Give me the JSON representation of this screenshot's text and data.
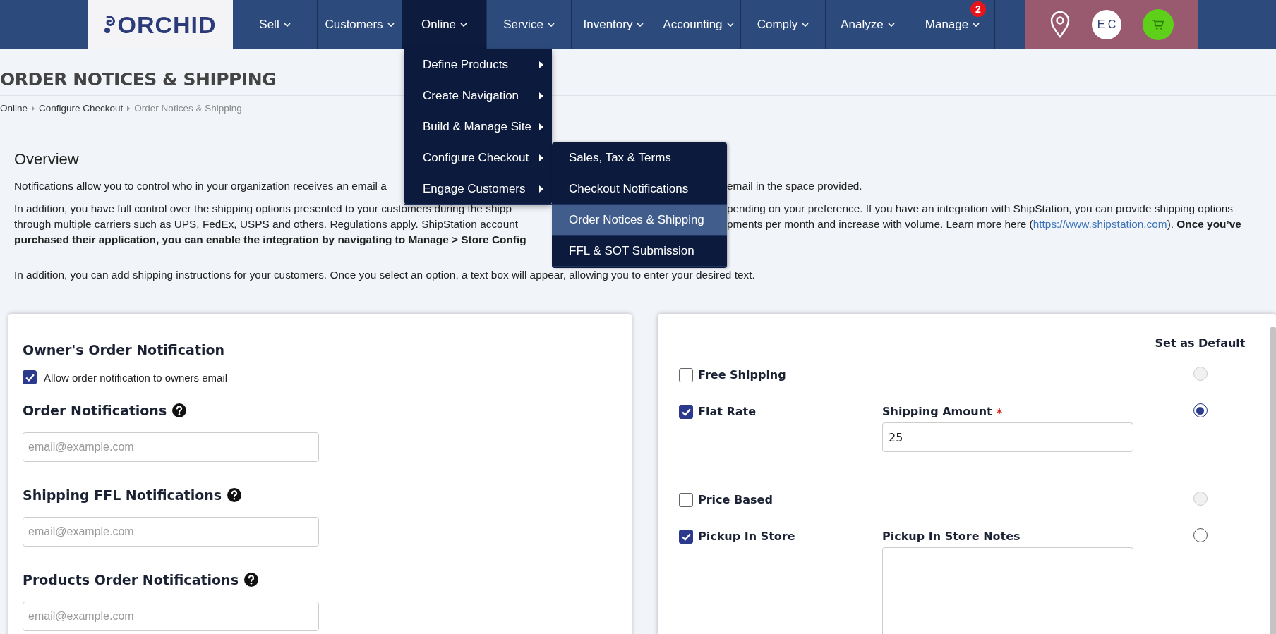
{
  "nav": {
    "logo": "ORCHID",
    "items": [
      {
        "label": "Sell",
        "selected": false
      },
      {
        "label": "Customers",
        "selected": false
      },
      {
        "label": "Online",
        "selected": true
      },
      {
        "label": "Service",
        "selected": false
      },
      {
        "label": "Inventory",
        "selected": false
      },
      {
        "label": "Accounting",
        "selected": false
      },
      {
        "label": "Comply",
        "selected": false
      },
      {
        "label": "Analyze",
        "selected": false
      },
      {
        "label": "Manage",
        "selected": false,
        "badge": "2"
      }
    ],
    "avatar": "E C"
  },
  "page": {
    "title": "ORDER NOTICES & SHIPPING",
    "breadcrumb": [
      "Online",
      "Configure Checkout",
      "Order Notices & Shipping"
    ]
  },
  "overview": {
    "title": "Overview",
    "paragraphs": [
      {
        "lines": [
          {
            "left": "Notifications allow you to control who in your organization receives an email a",
            "right": "email in the space provided."
          }
        ]
      },
      {
        "lines": [
          {
            "left": "In addition, you have full control over the shipping options presented to your customers during the shipp",
            "right": "pending on your preference. If you have an integration with ShipStation, you can provide shipping options"
          },
          {
            "left": "through multiple carriers such as UPS, FedEx, USPS and others. Regulations apply. ShipStation account",
            "right": "pments per month and increase with volume. Learn more here (",
            "link": "https://www.shipstation.com",
            "after": "). **Once you’ve**"
          },
          {
            "left": "**purchased their application, you can enable the integration by navigating to Manage > Store Config**"
          }
        ]
      },
      {
        "lines": [
          {
            "left": "In addition, you can add shipping instructions for your customers. Once you select an option, a text box will appear, allowing you to enter your desired text."
          }
        ]
      }
    ]
  },
  "menu": {
    "items": [
      {
        "label": "Define Products"
      },
      {
        "label": "Create Navigation"
      },
      {
        "label": "Build & Manage Site"
      },
      {
        "label": "Configure Checkout"
      },
      {
        "label": "Engage Customers"
      }
    ],
    "submenu": [
      {
        "label": "Sales, Tax & Terms",
        "selected": false
      },
      {
        "label": "Checkout Notifications",
        "selected": false
      },
      {
        "label": "Order Notices & Shipping",
        "selected": true
      },
      {
        "label": "FFL & SOT Submission",
        "selected": false
      }
    ]
  },
  "notifications": {
    "title": "Owner's Order Notification",
    "allow": {
      "label": "Allow order notification to owners email",
      "checked": true
    },
    "fields": [
      {
        "label": "Order Notifications",
        "placeholder": "email@example.com"
      },
      {
        "label": "Shipping FFL Notifications",
        "placeholder": "email@example.com"
      },
      {
        "label": "Products Order Notifications",
        "placeholder": "email@example.com"
      }
    ]
  },
  "shipping": {
    "default_header": "Set as Default",
    "options": [
      {
        "label": "Free Shipping",
        "checked": false,
        "default": false,
        "disabled": true
      },
      {
        "label": "Flat Rate",
        "checked": true,
        "default": true,
        "disabled": false,
        "field": {
          "kind": "input",
          "label": "Shipping Amount",
          "required": true,
          "value": "25"
        }
      },
      {
        "label": "Price Based",
        "checked": false,
        "default": false,
        "disabled": true
      },
      {
        "label": "Pickup In Store",
        "checked": true,
        "default": false,
        "disabled": false,
        "field": {
          "kind": "textarea",
          "label": "Pickup In Store Notes",
          "required": false
        }
      }
    ]
  }
}
